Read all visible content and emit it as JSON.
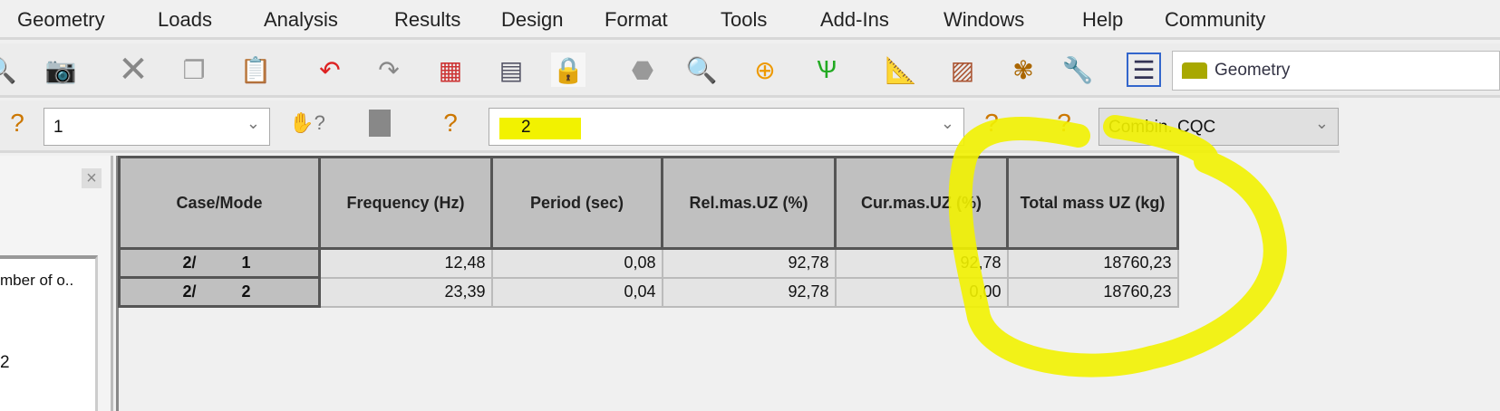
{
  "menu": [
    "Geometry",
    "Loads",
    "Analysis",
    "Results",
    "Design",
    "Format",
    "Tools",
    "Add-Ins",
    "Windows",
    "Help",
    "Community"
  ],
  "toolbar": {
    "layout_select": "Geometry"
  },
  "toolbar2": {
    "case_select": "1",
    "mode_select": "2",
    "combination_select": "Combin. CQC"
  },
  "left_panel": {
    "item_label": "mber of o..",
    "item_value": "2"
  },
  "table": {
    "headers": [
      "Case/Mode",
      "Frequency (Hz)",
      "Period (sec)",
      "Rel.mas.UZ (%)",
      "Cur.mas.UZ (%)",
      "Total mass UZ (kg)"
    ],
    "rows": [
      {
        "case": "2/",
        "mode": "1",
        "freq": "12,48",
        "period": "0,08",
        "rel": "92,78",
        "cur": "92,78",
        "total": "18760,23"
      },
      {
        "case": "2/",
        "mode": "2",
        "freq": "23,39",
        "period": "0,04",
        "rel": "92,78",
        "cur": "0,00",
        "total": "18760,23"
      }
    ]
  },
  "highlight_color": "#f2f200"
}
